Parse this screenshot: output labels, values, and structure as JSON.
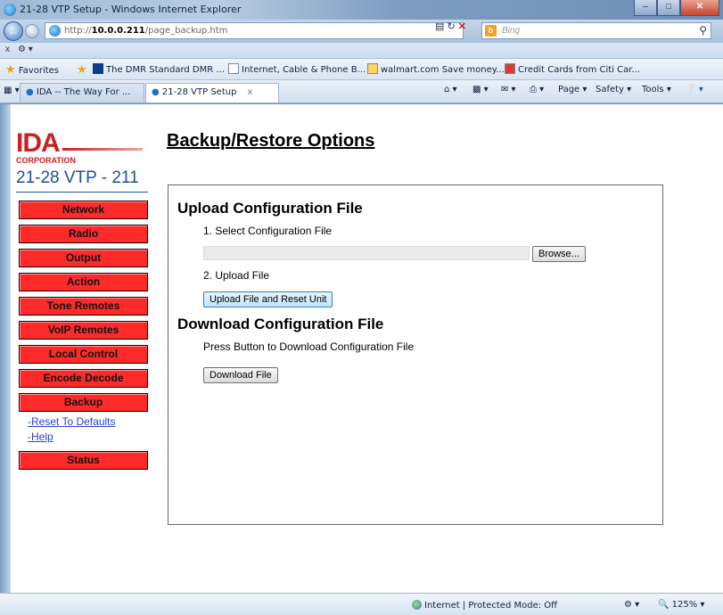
{
  "window": {
    "title": "21-28 VTP Setup - Windows Internet Explorer",
    "url_prefix": "http://",
    "url_host": "10.0.0.211",
    "url_path": "/page_backup.htm",
    "search_placeholder": "Bing"
  },
  "favorites": {
    "label": "Favorites",
    "items": [
      "The DMR Standard  DMR ...",
      "Internet, Cable & Phone B...",
      "walmart.com Save money...",
      "Credit Cards from Citi Car..."
    ]
  },
  "tabs": [
    {
      "label": "IDA -- The Way For ..."
    },
    {
      "label": "21-28 VTP Setup"
    }
  ],
  "toolbar": {
    "page": "Page",
    "safety": "Safety",
    "tools": "Tools"
  },
  "sidebar": {
    "logo_text": "IDA",
    "logo_sub": "CORPORATION",
    "unit_name": "21-28 VTP - 211",
    "menu": [
      "Network",
      "Radio",
      "Output",
      "Action",
      "Tone Remotes",
      "VoIP Remotes",
      "Local Control",
      "Encode Decode",
      "Backup"
    ],
    "backup_links": [
      "-Reset To Defaults",
      "-Help"
    ],
    "status": "Status"
  },
  "main": {
    "title": "Backup/Restore Options",
    "upload": {
      "heading": "Upload Configuration File",
      "step1": "1. Select Configuration File",
      "browse_label": "Browse...",
      "step2": "2. Upload File",
      "upload_button": "Upload File and Reset Unit"
    },
    "download": {
      "heading": "Download Configuration File",
      "instruction": "Press Button to Download Configuration File",
      "download_button": "Download File"
    }
  },
  "statusbar": {
    "zone": "Internet | Protected Mode: Off",
    "zoom": "125%"
  }
}
